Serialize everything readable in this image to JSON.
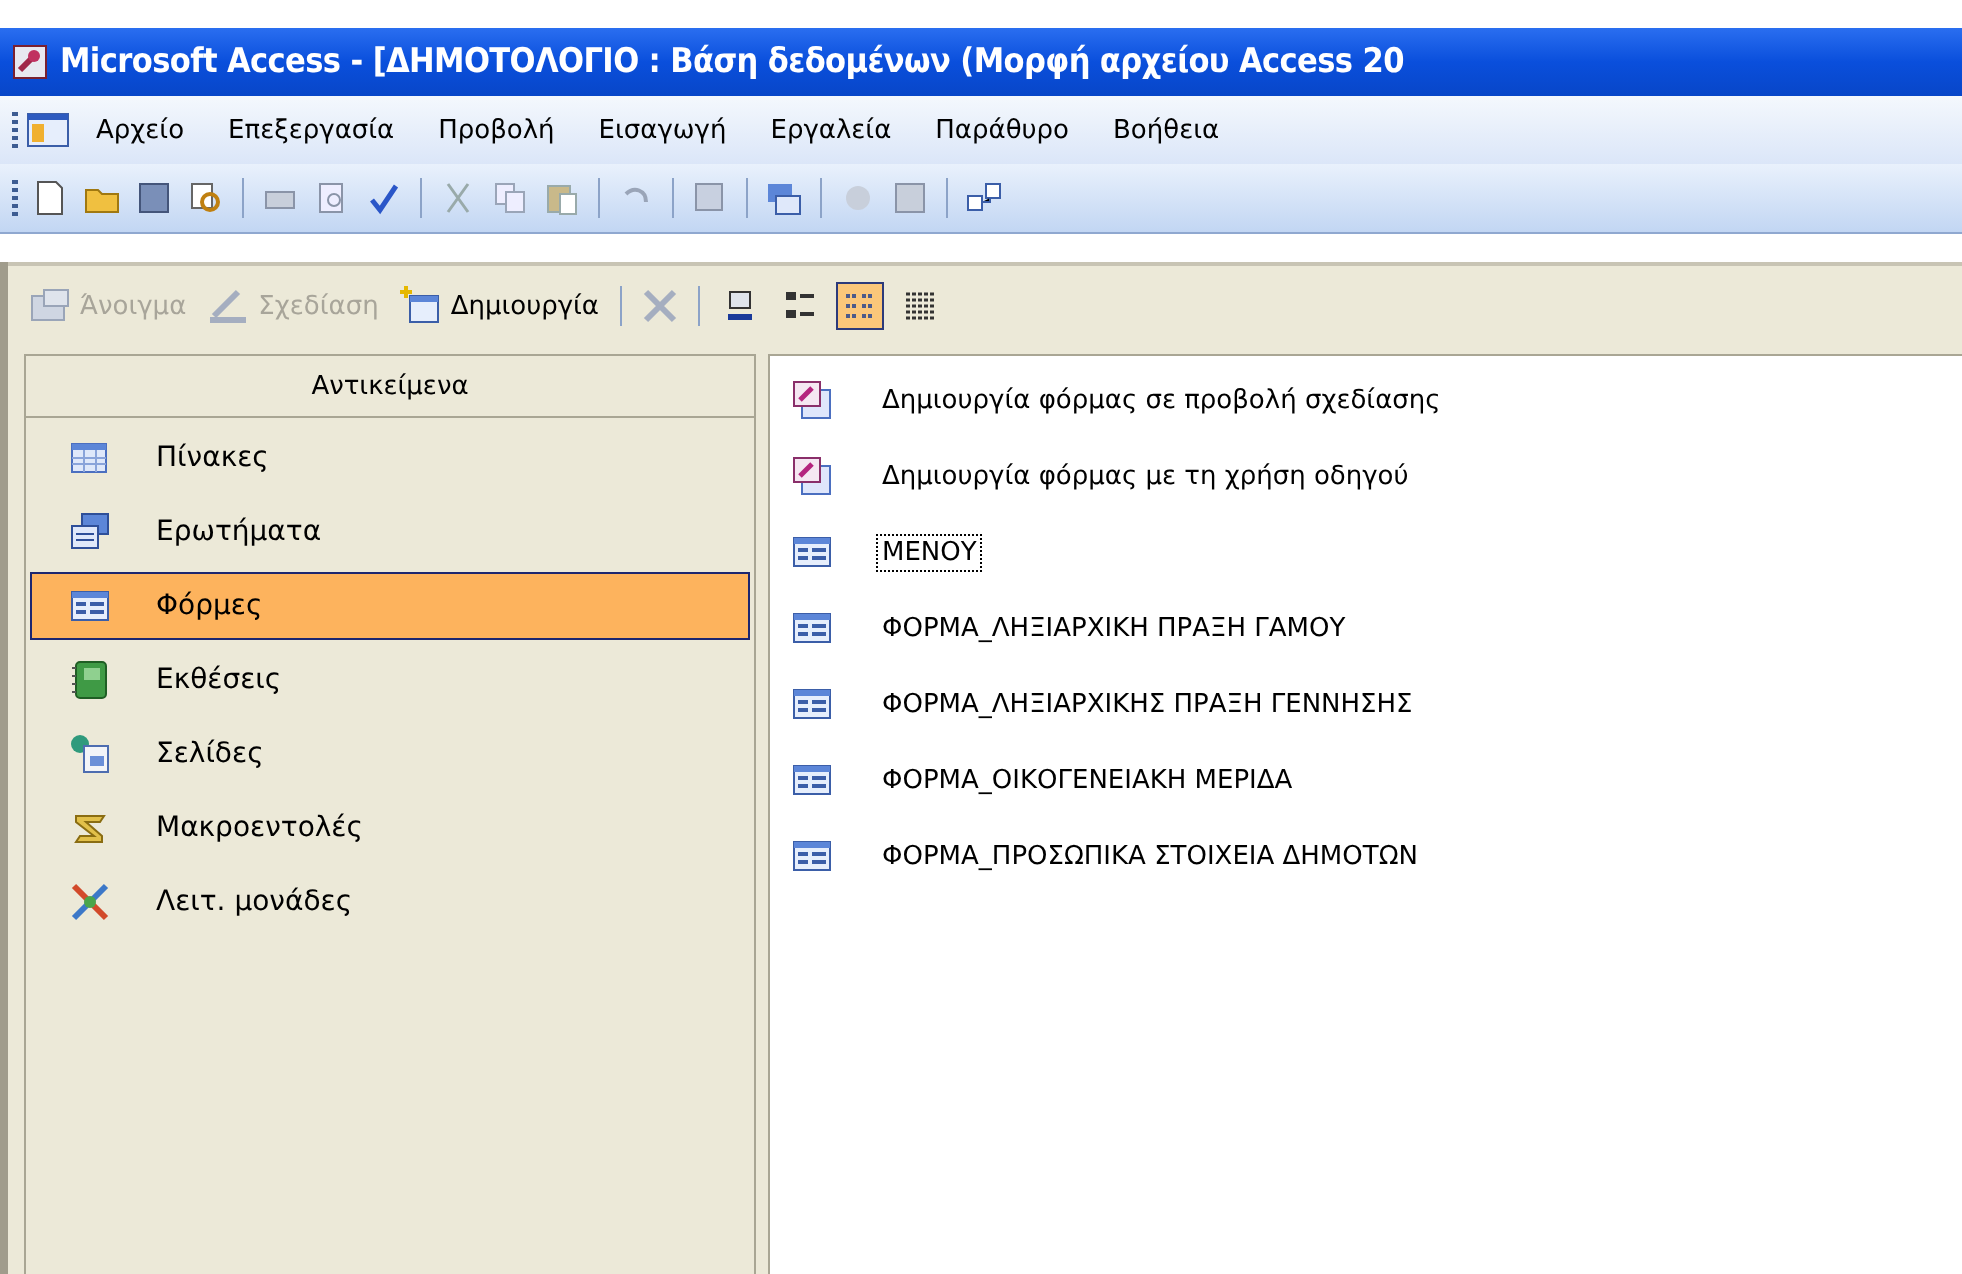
{
  "window": {
    "title": "Microsoft Access - [ΔΗΜΟΤΟΛΟΓΙΟ : Βάση δεδομένων (Μορφή αρχείου Access 20"
  },
  "menu": [
    "Αρχείο",
    "Επεξεργασία",
    "Προβολή",
    "Εισαγωγή",
    "Εργαλεία",
    "Παράθυρο",
    "Βοήθεια"
  ],
  "db_toolbar": {
    "buttons": [
      {
        "label": "Άνοιγμα",
        "kind": "open",
        "disabled": true
      },
      {
        "label": "Σχεδίαση",
        "kind": "design",
        "disabled": true
      },
      {
        "label": "Δημιουργία",
        "kind": "new",
        "disabled": false
      }
    ],
    "views": [
      {
        "kind": "large",
        "selected": false
      },
      {
        "kind": "small",
        "selected": false
      },
      {
        "kind": "list",
        "selected": true
      },
      {
        "kind": "details",
        "selected": false
      }
    ]
  },
  "sidebar": {
    "header": "Αντικείμενα",
    "items": [
      {
        "label": "Πίνακες",
        "kind": "table",
        "selected": false
      },
      {
        "label": "Ερωτήματα",
        "kind": "query",
        "selected": false
      },
      {
        "label": "Φόρμες",
        "kind": "form",
        "selected": true
      },
      {
        "label": "Εκθέσεις",
        "kind": "report",
        "selected": false
      },
      {
        "label": "Σελίδες",
        "kind": "page",
        "selected": false
      },
      {
        "label": "Μακροεντολές",
        "kind": "macro",
        "selected": false
      },
      {
        "label": "Λειτ. μονάδες",
        "kind": "module",
        "selected": false
      }
    ]
  },
  "objects": [
    {
      "label": "Δημιουργία φόρμας σε προβολή σχεδίασης",
      "kind": "wizard",
      "focused": false
    },
    {
      "label": "Δημιουργία φόρμας με τη χρήση οδηγού",
      "kind": "wizard",
      "focused": false
    },
    {
      "label": "ΜΕΝΟΥ",
      "kind": "form",
      "focused": true
    },
    {
      "label": "ΦΟΡΜΑ_ΛΗΞΙΑΡΧΙΚΗ ΠΡΑΞΗ ΓΑΜΟΥ",
      "kind": "form",
      "focused": false
    },
    {
      "label": "ΦΟΡΜΑ_ΛΗΞΙΑΡΧΙΚΗΣ ΠΡΑΞΗ ΓΕΝΝΗΣΗΣ",
      "kind": "form",
      "focused": false
    },
    {
      "label": "ΦΟΡΜΑ_ΟΙΚΟΓΕΝΕΙΑΚΗ ΜΕΡΙΔΑ",
      "kind": "form",
      "focused": false
    },
    {
      "label": "ΦΟΡΜΑ_ΠΡΟΣΩΠΙΚΑ ΣΤΟΙΧΕΙΑ ΔΗΜΟΤΩΝ",
      "kind": "form",
      "focused": false
    }
  ]
}
